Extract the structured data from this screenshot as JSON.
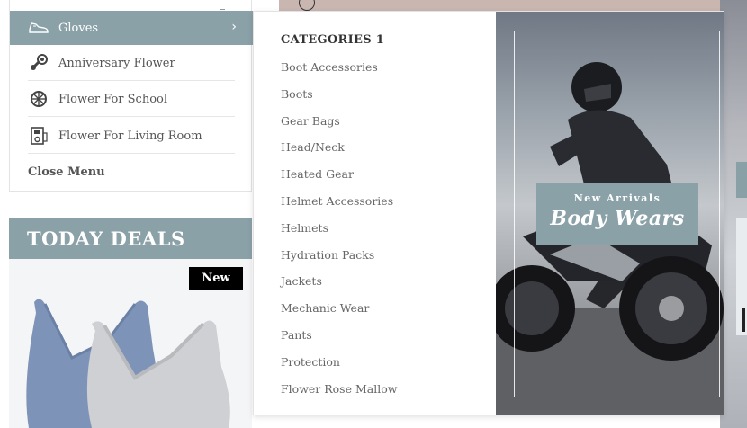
{
  "vertical_menu": {
    "items": [
      {
        "label": "Gloves",
        "icon": "shoe-icon",
        "active": true
      },
      {
        "label": "Anniversary Flower",
        "icon": "steam-icon"
      },
      {
        "label": "Flower For School",
        "icon": "wheel-icon"
      },
      {
        "label": "Flower For Living Room",
        "icon": "device-icon"
      }
    ],
    "close_label": "Close Menu"
  },
  "today_deals": {
    "title": "TODAY DEALS",
    "badge": "New"
  },
  "mega_menu": {
    "heading": "CATEGORIES 1",
    "categories": [
      "Boot Accessories",
      "Boots",
      "Gear Bags",
      "Head/Neck",
      "Heated Gear",
      "Helmet Accessories",
      "Helmets",
      "Hydration Packs",
      "Jackets",
      "Mechanic Wear",
      "Pants",
      "Protection",
      "Flower Rose Mallow"
    ],
    "promo": {
      "small_text": "New Arrivals",
      "big_text": "Body Wears"
    }
  },
  "colors": {
    "accent": "#8ba1a8",
    "badge_bg": "#000000"
  }
}
